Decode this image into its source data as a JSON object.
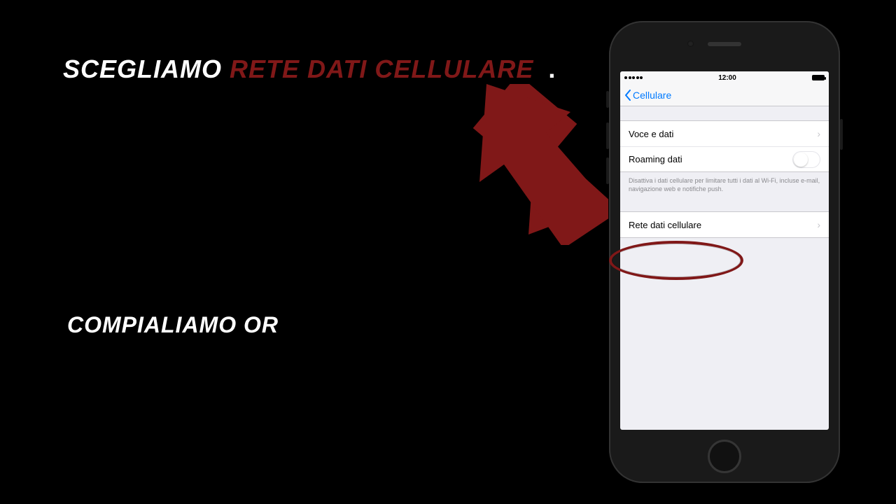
{
  "overlay": {
    "line1_prefix": "SCEGLIAMO",
    "line1_highlight": "RETE DATI CELLULARE",
    "line1_suffix": ".",
    "line2": "COMPIALIAMO OR"
  },
  "arrow": {
    "color": "#801818"
  },
  "phone": {
    "statusbar": {
      "time": "12:00"
    },
    "nav": {
      "back_label": "Cellulare"
    },
    "rows": {
      "voice_data": "Voce e dati",
      "roaming": "Roaming dati",
      "network": "Rete dati cellulare"
    },
    "footer": "Disattiva i dati cellulare per limitare tutti i dati al Wi-Fi, incluse e-mail, navigazione web e notifiche push."
  },
  "highlight": {
    "color": "#801818"
  }
}
